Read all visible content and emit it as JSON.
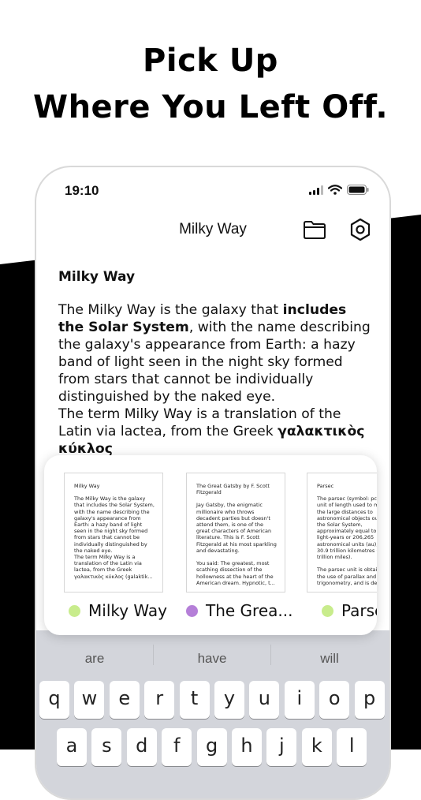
{
  "marketing": {
    "headline_line1": "Pick Up",
    "headline_line2": "Where You Left Off."
  },
  "status_bar": {
    "time": "19:10"
  },
  "nav": {
    "title": "Milky Way"
  },
  "document": {
    "title": "Milky Way",
    "paragraph1_prefix": "The Milky Way is the galaxy that ",
    "paragraph1_bold": "includes the Solar System",
    "paragraph1_suffix": ", with the name describing the galaxy's appearance from Earth: a hazy band of light seen in the night sky formed from stars that cannot be individually distinguished by the naked eye.",
    "paragraph2_prefix": "The term Milky Way is a translation of the Latin via lactea, from the Greek ",
    "paragraph2_bold": "γαλακτικὸς κύκλος"
  },
  "recent_cards": [
    {
      "thumb_title": "Milky Way",
      "thumb_body": "The Milky Way is the galaxy that includes the Solar System, with the name describing the galaxy's appearance from Earth: a hazy band of light seen in the night sky formed from stars that cannot be individually distinguished by the naked eye.\nThe term Milky Way is a translation of the Latin via lactea, from the Greek γαλακτικὸς κύκλος (galaktik...",
      "label": "Milky Way",
      "dot_color": "#c8ec8c"
    },
    {
      "thumb_title": "The Great Gatsby by F. Scott Fitzgerald",
      "thumb_body": "Jay Gatsby, the enigmatic millionaire who throws decadent parties but doesn't attend them, is one of the great characters of American literature. This is F. Scott Fitzgerald at his most sparkling and devastating.\n\nYou said: The greatest, most scathing dissection of the hollowness at the heart of the American dream. Hypnotic, t...",
      "label": "The Grea...",
      "dot_color": "#b57fd8"
    },
    {
      "thumb_title": "Parsec",
      "thumb_body": "The parsec (symbol: pc) is a unit of length used to measure the large distances to astronomical objects outside the Solar System, approximately equal to 3.26 light-years or 206,265 astronomical units (au), i.e. 30.9 trillion kilometres (19.2 trillion miles).\n\nThe parsec unit is obtained by the use of parallax and trigonometry, and is de...",
      "label": "Parsec",
      "dot_color": "#c8ec8c"
    }
  ],
  "keyboard": {
    "suggestions": [
      "are",
      "have",
      "will"
    ],
    "row1": [
      "q",
      "w",
      "e",
      "r",
      "t",
      "y",
      "u",
      "i",
      "o",
      "p"
    ],
    "row2": [
      "a",
      "s",
      "d",
      "f",
      "g",
      "h",
      "j",
      "k",
      "l"
    ]
  },
  "colors": {
    "background_shape": "#000000",
    "keyboard_bg": "#d3d5db"
  }
}
